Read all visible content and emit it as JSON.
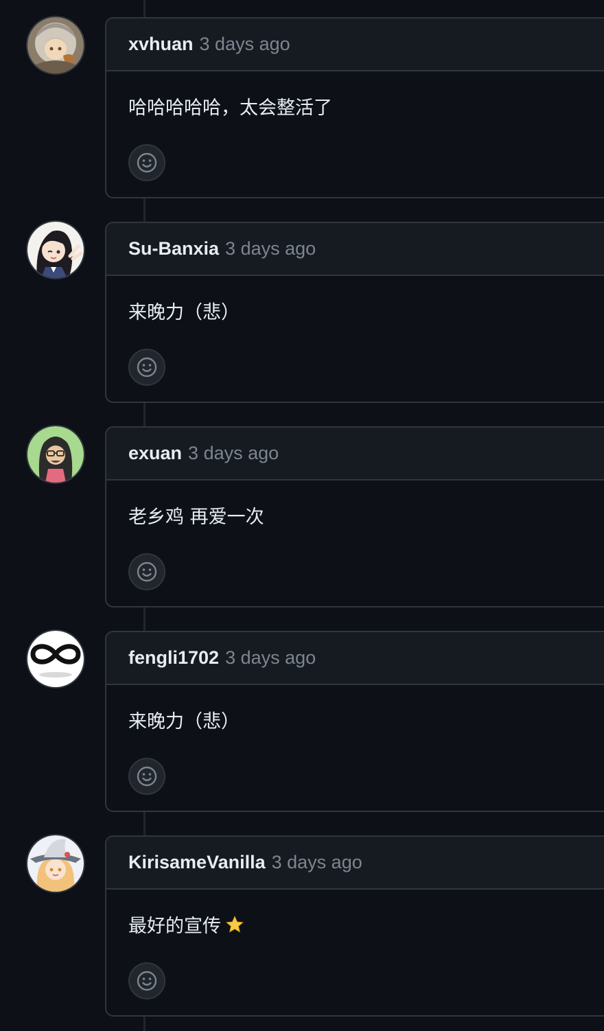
{
  "comments": [
    {
      "author": "xvhuan",
      "time": "3 days ago",
      "text": "哈哈哈哈哈，太会整活了",
      "avatar": "anime-gray-hair-avatar"
    },
    {
      "author": "Su-Banxia",
      "time": "3 days ago",
      "text": "来晚力（悲）",
      "avatar": "anime-black-hair-avatar"
    },
    {
      "author": "exuan",
      "time": "3 days ago",
      "text": "老乡鸡 再爱一次",
      "avatar": "hooded-figure-avatar"
    },
    {
      "author": "fengli1702",
      "time": "3 days ago",
      "text": "来晚力（悲）",
      "avatar": "infinity-symbol-avatar"
    },
    {
      "author": "KirisameVanilla",
      "time": "3 days ago",
      "text": "最好的宣传",
      "emoji": "star-icon",
      "avatar": "witch-hat-avatar"
    }
  ],
  "colors": {
    "background": "#0d1117",
    "header": "#161b22",
    "border": "#30363d",
    "muted_text": "#7d8590",
    "text": "#e6edf3"
  }
}
